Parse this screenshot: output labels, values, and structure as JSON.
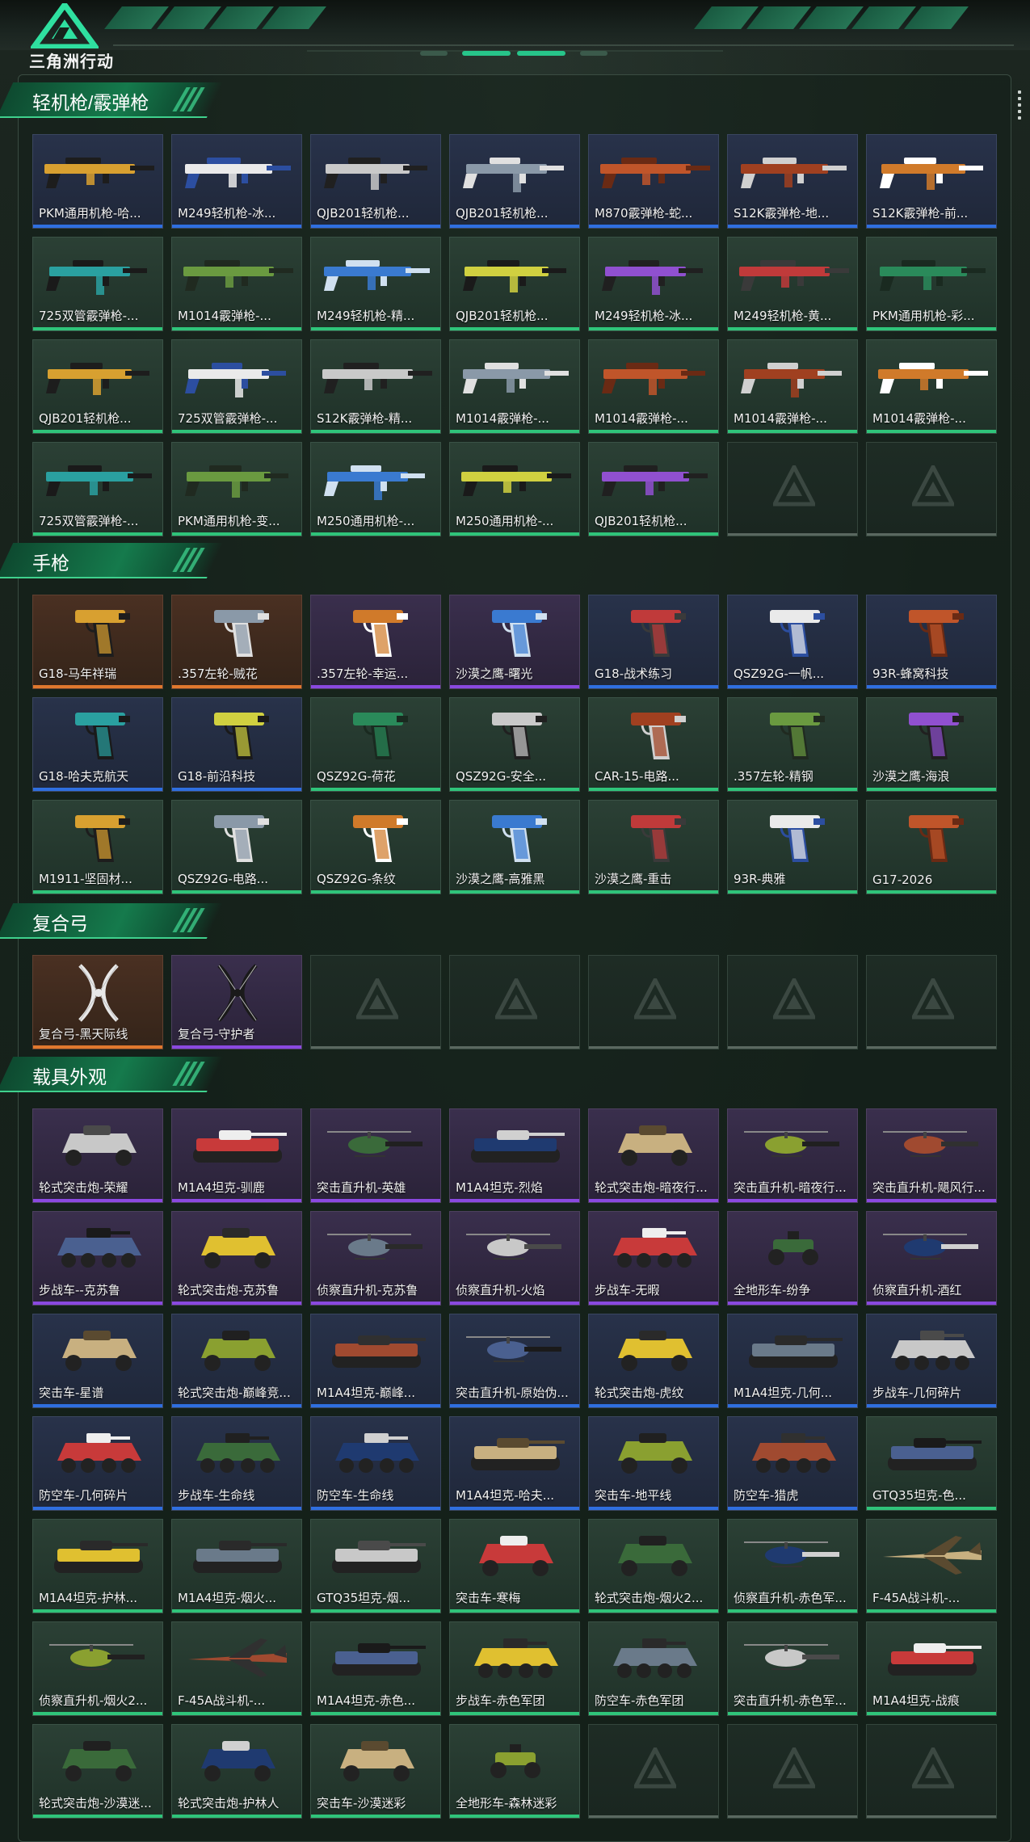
{
  "header": {
    "logo_text": "三角洲行动",
    "logo_icon": "delta-triangle-logo"
  },
  "colors": {
    "orange": "#e0782e",
    "purple": "#8a49e0",
    "blue": "#2f6fe0",
    "green": "#2fc47a",
    "accent": "#3fd18d"
  },
  "sections": [
    {
      "title": "轻机枪/霰弹枪",
      "type": "gun",
      "items": [
        {
          "label": "PKM通用机枪-哈...",
          "rarity": "blue"
        },
        {
          "label": "M249轻机枪-冰...",
          "rarity": "blue"
        },
        {
          "label": "QJB201轻机枪...",
          "rarity": "blue"
        },
        {
          "label": "QJB201轻机枪...",
          "rarity": "blue"
        },
        {
          "label": "M870霰弹枪-蛇...",
          "rarity": "blue"
        },
        {
          "label": "S12K霰弹枪-地...",
          "rarity": "blue"
        },
        {
          "label": "S12K霰弹枪-前...",
          "rarity": "blue"
        },
        {
          "label": "725双管霰弹枪-...",
          "rarity": "green"
        },
        {
          "label": "M1014霰弹枪-...",
          "rarity": "green"
        },
        {
          "label": "M249轻机枪-精...",
          "rarity": "green"
        },
        {
          "label": "QJB201轻机枪...",
          "rarity": "green"
        },
        {
          "label": "M249轻机枪-冰...",
          "rarity": "green"
        },
        {
          "label": "M249轻机枪-黄...",
          "rarity": "green"
        },
        {
          "label": "PKM通用机枪-彩...",
          "rarity": "green"
        },
        {
          "label": "QJB201轻机枪...",
          "rarity": "green"
        },
        {
          "label": "725双管霰弹枪-...",
          "rarity": "green"
        },
        {
          "label": "S12K霰弹枪-精...",
          "rarity": "green"
        },
        {
          "label": "M1014霰弹枪-...",
          "rarity": "green"
        },
        {
          "label": "M1014霰弹枪-...",
          "rarity": "green"
        },
        {
          "label": "M1014霰弹枪-...",
          "rarity": "green"
        },
        {
          "label": "M1014霰弹枪-...",
          "rarity": "green"
        },
        {
          "label": "725双管霰弹枪-...",
          "rarity": "green"
        },
        {
          "label": "PKM通用机枪-变...",
          "rarity": "green"
        },
        {
          "label": "M250通用机枪-...",
          "rarity": "green"
        },
        {
          "label": "M250通用机枪-...",
          "rarity": "green"
        },
        {
          "label": "QJB201轻机枪...",
          "rarity": "green"
        },
        {
          "label": "",
          "rarity": "empty"
        },
        {
          "label": "",
          "rarity": "empty"
        }
      ]
    },
    {
      "title": "手枪",
      "type": "pistol",
      "items": [
        {
          "label": "G18-马年祥瑞",
          "rarity": "orange"
        },
        {
          "label": ".357左轮-贼花",
          "rarity": "orange"
        },
        {
          "label": ".357左轮-幸运...",
          "rarity": "purple"
        },
        {
          "label": "沙漠之鹰-曙光",
          "rarity": "purple"
        },
        {
          "label": "G18-战术练习",
          "rarity": "blue"
        },
        {
          "label": "QSZ92G-一帆...",
          "rarity": "blue"
        },
        {
          "label": "93R-蜂窝科技",
          "rarity": "blue"
        },
        {
          "label": "G18-哈夫克航天",
          "rarity": "blue"
        },
        {
          "label": "G18-前沿科技",
          "rarity": "blue"
        },
        {
          "label": "QSZ92G-荷花",
          "rarity": "green"
        },
        {
          "label": "QSZ92G-安全...",
          "rarity": "green"
        },
        {
          "label": "CAR-15-电路...",
          "rarity": "green"
        },
        {
          "label": ".357左轮-精钢",
          "rarity": "green"
        },
        {
          "label": "沙漠之鹰-海浪",
          "rarity": "green"
        },
        {
          "label": "M1911-坚固材...",
          "rarity": "green"
        },
        {
          "label": "QSZ92G-电路...",
          "rarity": "green"
        },
        {
          "label": "QSZ92G-条纹",
          "rarity": "green"
        },
        {
          "label": "沙漠之鹰-高雅黑",
          "rarity": "green"
        },
        {
          "label": "沙漠之鹰-重击",
          "rarity": "green"
        },
        {
          "label": "93R-典雅",
          "rarity": "green"
        },
        {
          "label": "G17-2026",
          "rarity": "green"
        }
      ]
    },
    {
      "title": "复合弓",
      "type": "bow",
      "items": [
        {
          "label": "复合弓-黑天际线",
          "rarity": "orange"
        },
        {
          "label": "复合弓-守护者",
          "rarity": "purple"
        },
        {
          "label": "",
          "rarity": "empty"
        },
        {
          "label": "",
          "rarity": "empty"
        },
        {
          "label": "",
          "rarity": "empty"
        },
        {
          "label": "",
          "rarity": "empty"
        },
        {
          "label": "",
          "rarity": "empty"
        }
      ]
    },
    {
      "title": "载具外观",
      "type": "vehicle",
      "items": [
        {
          "label": "轮式突击炮-荣耀",
          "rarity": "purple",
          "kind": "car"
        },
        {
          "label": "M1A4坦克-驯鹿",
          "rarity": "purple",
          "kind": "tank"
        },
        {
          "label": "突击直升机-英雄",
          "rarity": "purple",
          "kind": "heli"
        },
        {
          "label": "M1A4坦克-烈焰",
          "rarity": "purple",
          "kind": "tank"
        },
        {
          "label": "轮式突击炮-暗夜行...",
          "rarity": "purple",
          "kind": "car"
        },
        {
          "label": "突击直升机-暗夜行...",
          "rarity": "purple",
          "kind": "heli"
        },
        {
          "label": "突击直升机-飓风行...",
          "rarity": "purple",
          "kind": "heli"
        },
        {
          "label": "步战车--克苏鲁",
          "rarity": "purple",
          "kind": "apc"
        },
        {
          "label": "轮式突击炮-克苏鲁",
          "rarity": "purple",
          "kind": "car"
        },
        {
          "label": "侦察直升机-克苏鲁",
          "rarity": "purple",
          "kind": "heli"
        },
        {
          "label": "侦察直升机-火焰",
          "rarity": "purple",
          "kind": "heli"
        },
        {
          "label": "步战车-无暇",
          "rarity": "purple",
          "kind": "apc"
        },
        {
          "label": "全地形车-纷争",
          "rarity": "purple",
          "kind": "atv"
        },
        {
          "label": "侦察直升机-酒红",
          "rarity": "purple",
          "kind": "heli"
        },
        {
          "label": "突击车-星谱",
          "rarity": "blue",
          "kind": "car"
        },
        {
          "label": "轮式突击炮-巅峰竞...",
          "rarity": "blue",
          "kind": "car"
        },
        {
          "label": "M1A4坦克-巅峰...",
          "rarity": "blue",
          "kind": "tank"
        },
        {
          "label": "突击直升机-原始伪...",
          "rarity": "blue",
          "kind": "heli"
        },
        {
          "label": "轮式突击炮-虎纹",
          "rarity": "blue",
          "kind": "car"
        },
        {
          "label": "M1A4坦克-几何...",
          "rarity": "blue",
          "kind": "tank"
        },
        {
          "label": "步战车-几何碎片",
          "rarity": "blue",
          "kind": "apc"
        },
        {
          "label": "防空车-几何碎片",
          "rarity": "blue",
          "kind": "apc"
        },
        {
          "label": "步战车-生命线",
          "rarity": "blue",
          "kind": "apc"
        },
        {
          "label": "防空车-生命线",
          "rarity": "blue",
          "kind": "apc"
        },
        {
          "label": "M1A4坦克-哈夫...",
          "rarity": "blue",
          "kind": "tank"
        },
        {
          "label": "突击车-地平线",
          "rarity": "blue",
          "kind": "car"
        },
        {
          "label": "防空车-猎虎",
          "rarity": "blue",
          "kind": "apc"
        },
        {
          "label": "GTQ35坦克-色...",
          "rarity": "green",
          "kind": "tank"
        },
        {
          "label": "M1A4坦克-护林...",
          "rarity": "green",
          "kind": "tank"
        },
        {
          "label": "M1A4坦克-烟火...",
          "rarity": "green",
          "kind": "tank"
        },
        {
          "label": "GTQ35坦克-烟...",
          "rarity": "green",
          "kind": "tank"
        },
        {
          "label": "突击车-寒梅",
          "rarity": "green",
          "kind": "car"
        },
        {
          "label": "轮式突击炮-烟火2...",
          "rarity": "green",
          "kind": "car"
        },
        {
          "label": "侦察直升机-赤色军...",
          "rarity": "green",
          "kind": "heli"
        },
        {
          "label": "F-45A战斗机-...",
          "rarity": "green",
          "kind": "jet"
        },
        {
          "label": "侦察直升机-烟火2...",
          "rarity": "green",
          "kind": "heli"
        },
        {
          "label": "F-45A战斗机-...",
          "rarity": "green",
          "kind": "jet"
        },
        {
          "label": "M1A4坦克-赤色...",
          "rarity": "green",
          "kind": "tank"
        },
        {
          "label": "步战车-赤色军团",
          "rarity": "green",
          "kind": "apc"
        },
        {
          "label": "防空车-赤色军团",
          "rarity": "green",
          "kind": "apc"
        },
        {
          "label": "突击直升机-赤色军...",
          "rarity": "green",
          "kind": "heli"
        },
        {
          "label": "M1A4坦克-战痕",
          "rarity": "green",
          "kind": "tank"
        },
        {
          "label": "轮式突击炮-沙漠迷...",
          "rarity": "green",
          "kind": "car"
        },
        {
          "label": "轮式突击炮-护林人",
          "rarity": "green",
          "kind": "car"
        },
        {
          "label": "突击车-沙漠迷彩",
          "rarity": "green",
          "kind": "car"
        },
        {
          "label": "全地形车-森林迷彩",
          "rarity": "green",
          "kind": "atv"
        },
        {
          "label": "",
          "rarity": "empty"
        },
        {
          "label": "",
          "rarity": "empty"
        },
        {
          "label": "",
          "rarity": "empty"
        }
      ]
    }
  ]
}
